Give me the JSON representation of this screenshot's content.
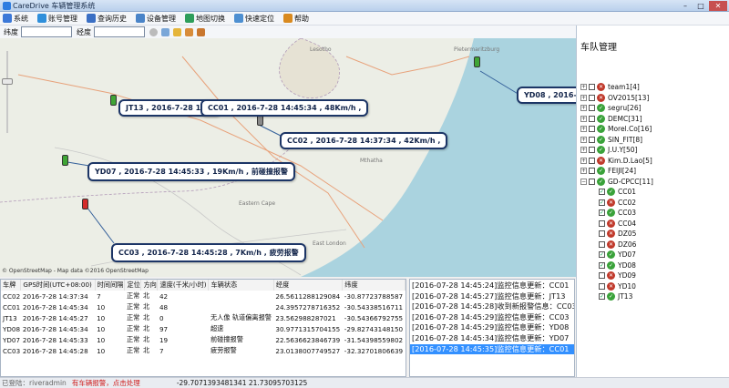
{
  "window": {
    "title": "CareDrive 车辆管理系统"
  },
  "menu": [
    {
      "label": "系统",
      "icon": "system-icon",
      "color": "#3b78d8"
    },
    {
      "label": "账号管理",
      "icon": "account-icon",
      "color": "#2f8fdb"
    },
    {
      "label": "查询历史",
      "icon": "history-icon",
      "color": "#3a6fc4"
    },
    {
      "label": "设备管理",
      "icon": "device-icon",
      "color": "#4a84c8"
    },
    {
      "label": "地图切换",
      "icon": "map-switch-icon",
      "color": "#2e9e5b"
    },
    {
      "label": "快速定位",
      "icon": "locate-icon",
      "color": "#4d8fd1"
    },
    {
      "label": "帮助",
      "icon": "help-icon",
      "color": "#d98a1f"
    }
  ],
  "toolbar": {
    "lat_label": "纬度",
    "lon_label": "经度",
    "lat_value": "",
    "lon_value": ""
  },
  "map": {
    "labels": [
      "Lesotho",
      "Pietermaritzburg",
      "Eastern Cape",
      "Mthatha",
      "East London"
    ],
    "attribution": "© OpenStreetMap - Map data ©2016 OpenStreetMap",
    "callouts": [
      {
        "text": "JT13 , 2016-7-28 14:4"
      },
      {
        "text": "CC01 , 2016-7-28 14:45:34 , 48Km/h ,"
      },
      {
        "text": "CC02 , 2016-7-28 14:37:34 , 42Km/h ,"
      },
      {
        "text": "YD07 , 2016-7-28 14:45:33 , 19Km/h , 前碰撞报警"
      },
      {
        "text": "CC03 , 2016-7-28 14:45:28 , 7Km/h , 疲劳报警"
      },
      {
        "text": "YD08 , 2016-7-28 1"
      }
    ]
  },
  "fleet": {
    "title": "车队管理",
    "groups": [
      {
        "name": "team1[4]",
        "status": "red"
      },
      {
        "name": "OV2015[13]",
        "status": "red"
      },
      {
        "name": "segru[26]",
        "status": "green"
      },
      {
        "name": "DEMC[31]",
        "status": "green"
      },
      {
        "name": "Morel.Co[16]",
        "status": "green"
      },
      {
        "name": "SIN_FIT[8]",
        "status": "green"
      },
      {
        "name": "J.U.Y[50]",
        "status": "green"
      },
      {
        "name": "Kim.D.Lao[5]",
        "status": "red"
      },
      {
        "name": "FEIJI[24]",
        "status": "green"
      }
    ],
    "open_group": {
      "name": "GD-CPCC[11]",
      "status": "green"
    },
    "vehicles": [
      {
        "name": "CC01",
        "status": "green",
        "checked": true
      },
      {
        "name": "CC02",
        "status": "red",
        "checked": true
      },
      {
        "name": "CC03",
        "status": "green",
        "checked": true
      },
      {
        "name": "CC04",
        "status": "red",
        "checked": false
      },
      {
        "name": "DZ05",
        "status": "red",
        "checked": false
      },
      {
        "name": "DZ06",
        "status": "red",
        "checked": false
      },
      {
        "name": "YD07",
        "status": "green",
        "checked": true
      },
      {
        "name": "YD08",
        "status": "green",
        "checked": true
      },
      {
        "name": "YD09",
        "status": "red",
        "checked": false
      },
      {
        "name": "YD10",
        "status": "red",
        "checked": false
      },
      {
        "name": "JT13",
        "status": "green",
        "checked": true
      }
    ]
  },
  "table": {
    "headers": [
      "车牌",
      "GPS时间(UTC+08:00)",
      "时间间隔",
      "定位",
      "方向",
      "速度(千米/小时)",
      "车辆状态",
      "经度",
      "纬度"
    ],
    "rows": [
      [
        "CC02",
        "2016-7-28 14:37:34",
        "7",
        "正常",
        "北",
        "42",
        "",
        "26.5611288129084",
        "-30.87723788587"
      ],
      [
        "CC01",
        "2016-7-28 14:45:34",
        "10",
        "正常",
        "北",
        "48",
        "",
        "24.3957278716352",
        "-30.54338516711"
      ],
      [
        "JT13",
        "2016-7-28 14:45:27",
        "10",
        "正常",
        "北",
        "0",
        "无人像 轨道偏离报警",
        "23.562988287021",
        "-30.54366792755"
      ],
      [
        "YD08",
        "2016-7-28 14:45:34",
        "10",
        "正常",
        "北",
        "97",
        "超速",
        "30.9771315704155",
        "-29.82743148150"
      ],
      [
        "YD07",
        "2016-7-28 14:45:33",
        "10",
        "正常",
        "北",
        "19",
        "前碰撞报警",
        "22.5636623846739",
        "-31.54398559802"
      ],
      [
        "CC03",
        "2016-7-28 14:45:28",
        "10",
        "正常",
        "北",
        "7",
        "疲劳报警",
        "23.0138007749527",
        "-32.32701806639"
      ]
    ]
  },
  "log": [
    {
      "text": "[2016-07-28 14:45:24]监控信息更新：CC01",
      "selected": false
    },
    {
      "text": "[2016-07-28 14:45:27]监控信息更新：JT13",
      "selected": false
    },
    {
      "text": "[2016-07-28 14:45:28]收到新报警信息：CC03",
      "selected": false
    },
    {
      "text": "[2016-07-28 14:45:29]监控信息更新：CC03",
      "selected": false
    },
    {
      "text": "[2016-07-28 14:45:29]监控信息更新：YD08",
      "selected": false
    },
    {
      "text": "[2016-07-28 14:45:34]监控信息更新：YD07",
      "selected": false
    },
    {
      "text": "[2016-07-28 14:45:35]监控信息更新：CC01",
      "selected": true
    }
  ],
  "status": {
    "login": "已登陆：riveradmin",
    "alarm": "有车辆报警，点击处理",
    "coords": "-29.7071393481341 21.73095703125"
  }
}
